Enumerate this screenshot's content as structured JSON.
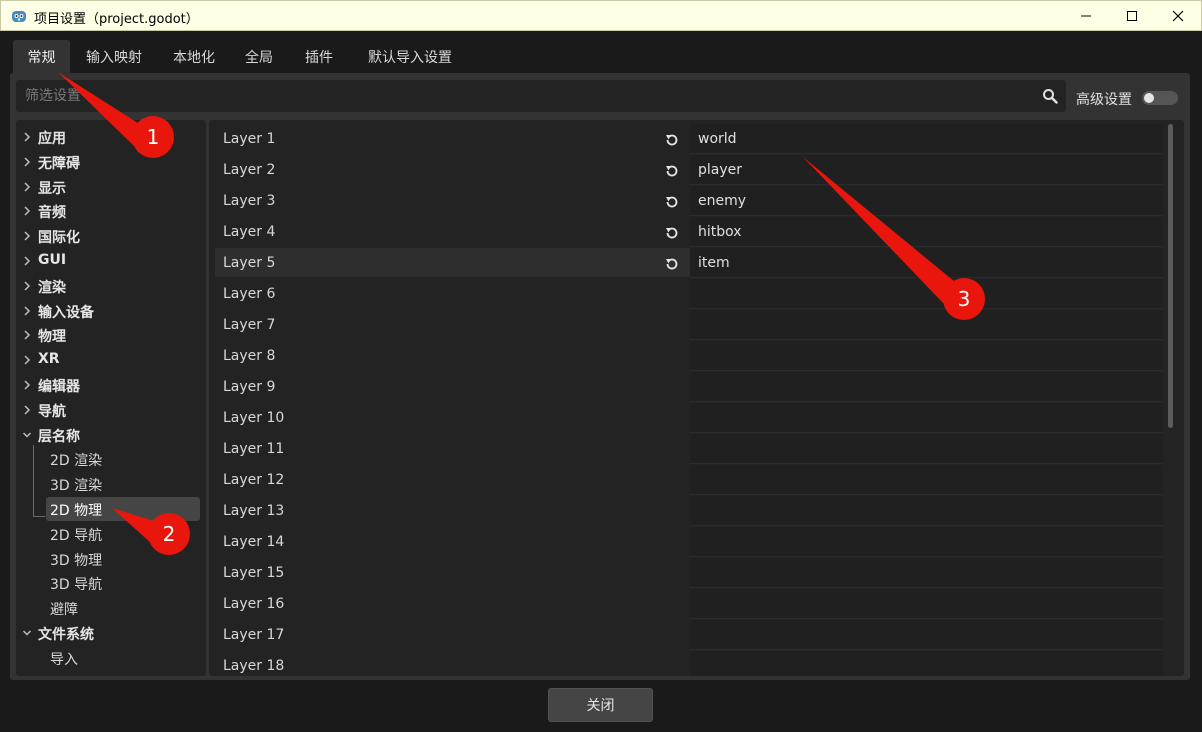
{
  "window": {
    "title": "项目设置（project.godot）",
    "icons": {
      "app": "godot-icon",
      "minimize": "minimize-icon",
      "maximize": "maximize-icon",
      "close": "close-icon"
    }
  },
  "tabs": [
    {
      "label": "常规",
      "active": true
    },
    {
      "label": "输入映射"
    },
    {
      "label": "本地化"
    },
    {
      "label": "全局"
    },
    {
      "label": "插件"
    },
    {
      "label": "默认导入设置"
    }
  ],
  "filter": {
    "placeholder": "筛选设置",
    "value": ""
  },
  "advanced": {
    "label": "高级设置",
    "enabled": false
  },
  "tree": [
    {
      "label": "应用",
      "expanded": false
    },
    {
      "label": "无障碍",
      "expanded": false
    },
    {
      "label": "显示",
      "expanded": false
    },
    {
      "label": "音频",
      "expanded": false
    },
    {
      "label": "国际化",
      "expanded": false
    },
    {
      "label": "GUI",
      "expanded": false
    },
    {
      "label": "渲染",
      "expanded": false
    },
    {
      "label": "输入设备",
      "expanded": false
    },
    {
      "label": "物理",
      "expanded": false
    },
    {
      "label": "XR",
      "expanded": false
    },
    {
      "label": "编辑器",
      "expanded": false
    },
    {
      "label": "导航",
      "expanded": false
    },
    {
      "label": "层名称",
      "expanded": true
    },
    {
      "label": "2D 渲染",
      "child": true
    },
    {
      "label": "3D 渲染",
      "child": true
    },
    {
      "label": "2D 物理",
      "child": true,
      "selected": true
    },
    {
      "label": "2D 导航",
      "child": true
    },
    {
      "label": "3D 物理",
      "child": true
    },
    {
      "label": "3D 导航",
      "child": true
    },
    {
      "label": "避障",
      "child": true
    },
    {
      "label": "文件系统",
      "expanded": true
    },
    {
      "label": "导入",
      "child": true
    }
  ],
  "layers": [
    {
      "name": "Layer 1",
      "value": "world",
      "revert": true
    },
    {
      "name": "Layer 2",
      "value": "player",
      "revert": true
    },
    {
      "name": "Layer 3",
      "value": "enemy",
      "revert": true
    },
    {
      "name": "Layer 4",
      "value": "hitbox",
      "revert": true
    },
    {
      "name": "Layer 5",
      "value": "item",
      "revert": true,
      "selected": true
    },
    {
      "name": "Layer 6",
      "value": ""
    },
    {
      "name": "Layer 7",
      "value": ""
    },
    {
      "name": "Layer 8",
      "value": ""
    },
    {
      "name": "Layer 9",
      "value": ""
    },
    {
      "name": "Layer 10",
      "value": ""
    },
    {
      "name": "Layer 11",
      "value": ""
    },
    {
      "name": "Layer 12",
      "value": ""
    },
    {
      "name": "Layer 13",
      "value": ""
    },
    {
      "name": "Layer 14",
      "value": ""
    },
    {
      "name": "Layer 15",
      "value": ""
    },
    {
      "name": "Layer 16",
      "value": ""
    },
    {
      "name": "Layer 17",
      "value": ""
    },
    {
      "name": "Layer 18",
      "value": ""
    }
  ],
  "footer": {
    "close_label": "关闭"
  },
  "annotations": [
    "1",
    "2",
    "3"
  ],
  "colors": {
    "annotation": "#e8160c",
    "titlebar": "#ffffe6",
    "panel": "#333333"
  }
}
